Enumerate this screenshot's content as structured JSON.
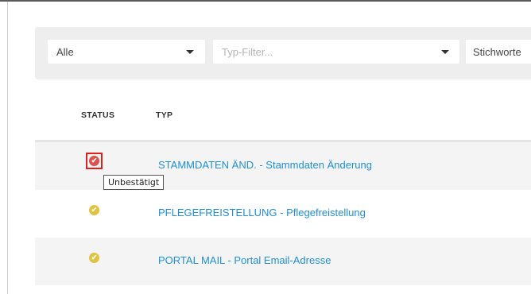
{
  "filters": {
    "status_select": "Alle",
    "type_filter_placeholder": "Typ-Filter...",
    "keywords_label": "Stichworte"
  },
  "table": {
    "columns": [
      "STATUS",
      "TYP"
    ],
    "rows": [
      {
        "status": "unconfirmed",
        "status_color": "#d9534f",
        "type": "STAMMDATEN ÄND. - Stammdaten Änderung"
      },
      {
        "status": "confirmed",
        "status_color": "#e0c341",
        "type": "PFLEGEFREISTELLUNG - Pflegefreistellung"
      },
      {
        "status": "confirmed",
        "status_color": "#e0c341",
        "type": "PORTAL MAIL - Portal Email-Adresse"
      }
    ]
  },
  "tooltip": {
    "text": "Unbestätigt"
  },
  "icons": {
    "status_check": "check-circle-icon",
    "dropdown": "caret-down-icon"
  },
  "colors": {
    "link": "#1f8fd6",
    "highlight_border": "#e0201b"
  }
}
